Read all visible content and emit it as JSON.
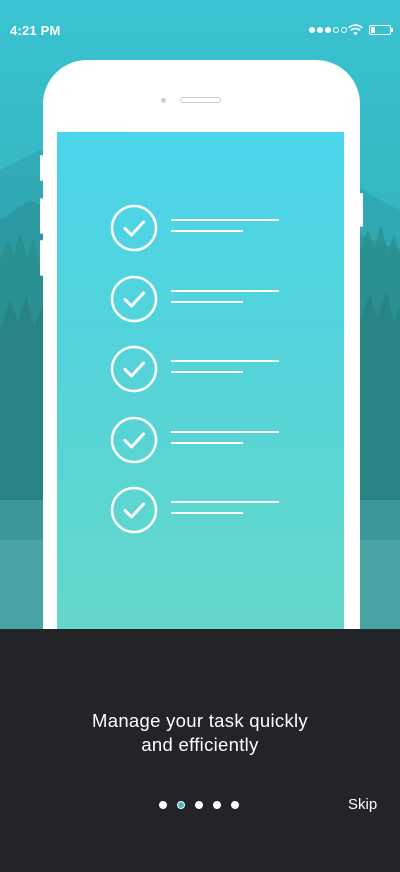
{
  "status_bar": {
    "time": "4:21 PM",
    "signal_bars_filled": 3,
    "signal_bars_total": 5,
    "battery_level": 0.2
  },
  "onboarding": {
    "headline_line1": "Manage your task quickly",
    "headline_line2": "and efficiently",
    "pages_total": 5,
    "active_page": 2,
    "skip_label": "Skip"
  },
  "mockup": {
    "task_count": 5
  },
  "colors": {
    "accent": "#4bb8c4",
    "panel": "#232428",
    "screen_top": "#4bd5ea",
    "screen_bottom": "#66d9c8"
  },
  "icons": {
    "check": "check-circle-icon",
    "wifi": "wifi-icon",
    "battery": "battery-icon"
  }
}
